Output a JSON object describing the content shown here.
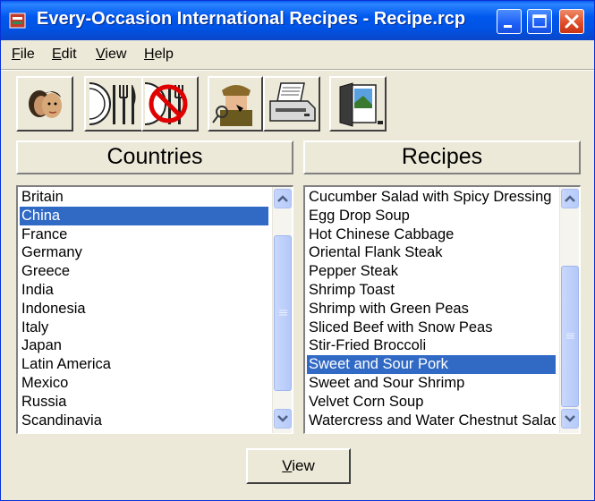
{
  "window": {
    "title": "Every-Occasion International Recipes - Recipe.rcp"
  },
  "menu": {
    "items": [
      {
        "label": "File",
        "accel": "F",
        "rest": "ile"
      },
      {
        "label": "Edit",
        "accel": "E",
        "rest": "dit"
      },
      {
        "label": "View",
        "accel": "V",
        "rest": "iew"
      },
      {
        "label": "Help",
        "accel": "H",
        "rest": "elp"
      }
    ]
  },
  "toolbar": {
    "buttons": [
      {
        "icon": "people-faces-icon"
      },
      {
        "icon": "plate-fork-knife-icon"
      },
      {
        "icon": "no-dining-icon"
      },
      {
        "icon": "detective-search-icon"
      },
      {
        "icon": "printer-icon"
      },
      {
        "icon": "exit-door-icon"
      }
    ]
  },
  "countries": {
    "header": "Countries",
    "items": [
      "Britain",
      "China",
      "France",
      "Germany",
      "Greece",
      "India",
      "Indonesia",
      "Italy",
      "Japan",
      "Latin America",
      "Mexico",
      "Russia",
      "Scandinavia"
    ],
    "selected": "China"
  },
  "recipes": {
    "header": "Recipes",
    "items": [
      "Cucumber Salad with Spicy Dressing",
      "Egg Drop Soup",
      "Hot Chinese Cabbage",
      "Oriental Flank Steak",
      "Pepper Steak",
      "Shrimp Toast",
      "Shrimp with Green Peas",
      "Sliced Beef with Snow Peas",
      "Stir-Fried Broccoli",
      "Sweet and Sour Pork",
      "Sweet and Sour Shrimp",
      "Velvet Corn Soup",
      "Watercress and Water Chestnut Salad"
    ],
    "selected": "Sweet and Sour Pork"
  },
  "view_button": {
    "label": "View",
    "accel": "V",
    "rest": "iew"
  },
  "colors": {
    "titlebar": "#0054e3",
    "selection": "#316ac5",
    "window_bg": "#ece9d8"
  }
}
